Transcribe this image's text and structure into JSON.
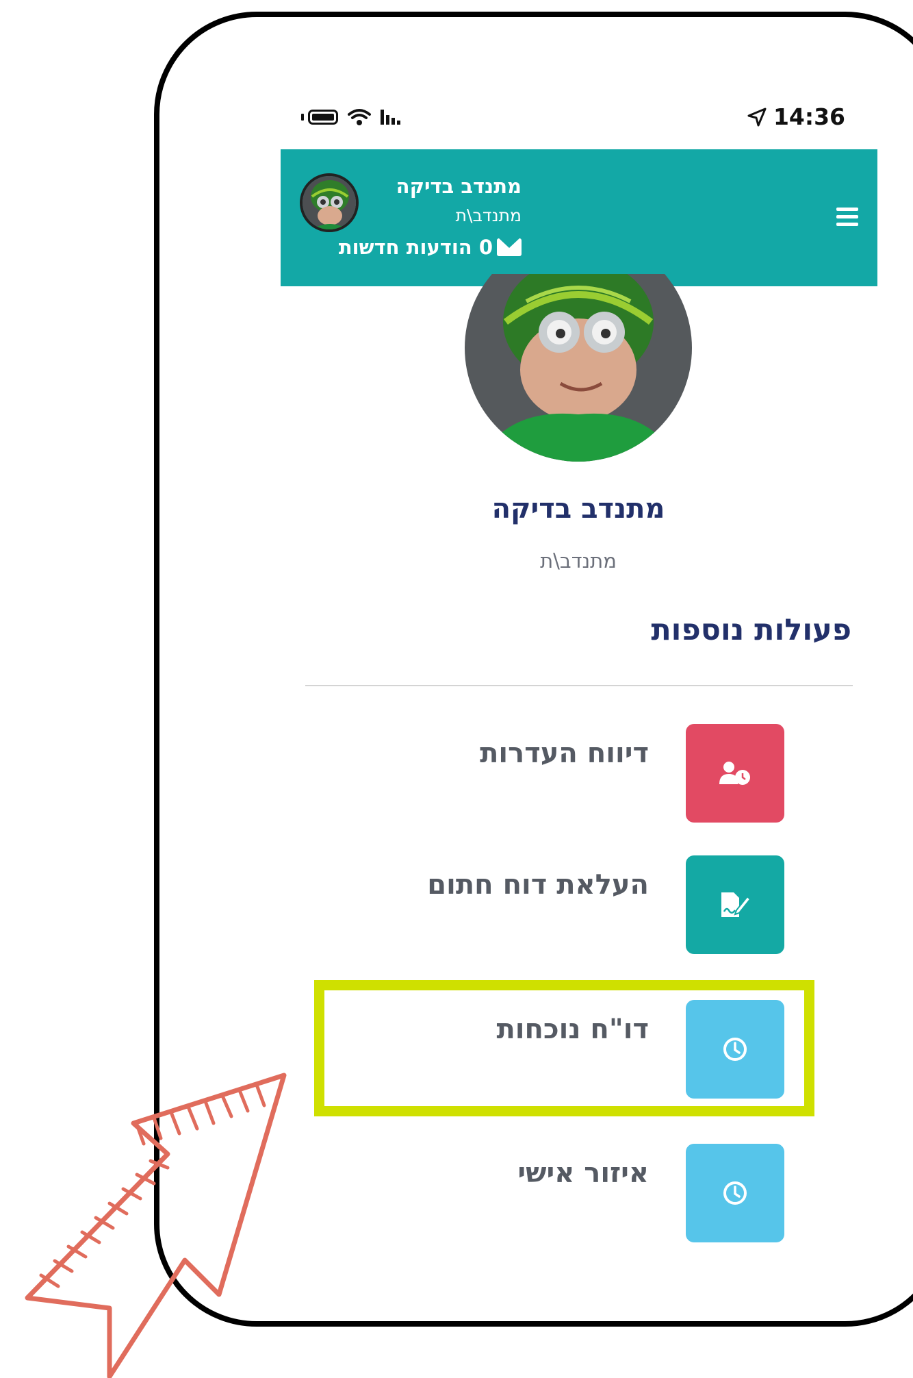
{
  "status_bar": {
    "time": "14:36"
  },
  "header": {
    "user_name": "מתנדב בדיקה",
    "role": "מתנדב\\ת",
    "messages_label": "0 הודעות חדשות"
  },
  "profile": {
    "name": "מתנדב בדיקה",
    "role": "מתנדב\\ת"
  },
  "section": {
    "title": "פעולות נוספות"
  },
  "actions": [
    {
      "label": "דיווח העדרות",
      "color": "#e24a63",
      "icon": "user-clock-icon"
    },
    {
      "label": "העלאת דוח חתום",
      "color": "#14a9a4",
      "icon": "file-signature-icon"
    },
    {
      "label": "דו\"ח נוכחות",
      "color": "#56c5ea",
      "icon": "clock-icon"
    },
    {
      "label": "איזור אישי",
      "color": "#56c5ea",
      "icon": "clock-icon"
    }
  ],
  "annotation": {
    "highlight_color": "#cfe000",
    "arrow_color": "#e06c5c"
  }
}
